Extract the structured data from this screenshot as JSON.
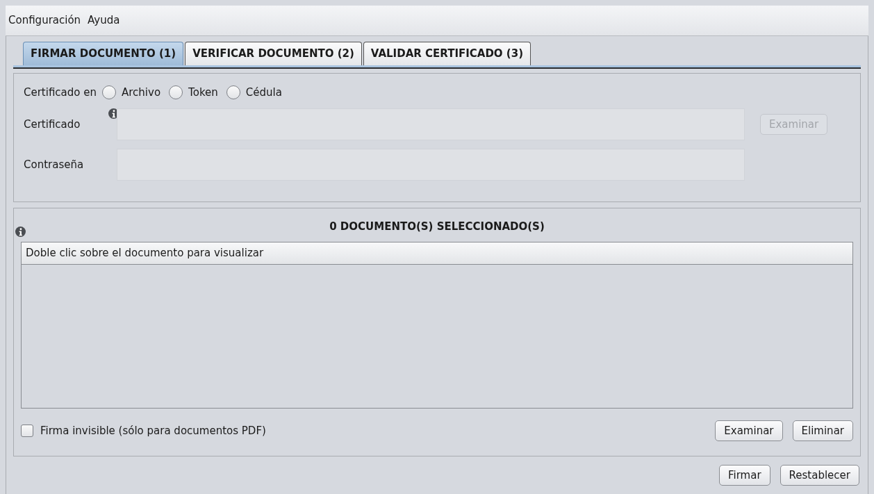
{
  "menu": [
    "Configuración",
    "Ayuda"
  ],
  "tabs": [
    {
      "label": "FIRMAR DOCUMENTO (1)",
      "selected": true
    },
    {
      "label": "VERIFICAR DOCUMENTO (2)",
      "selected": false
    },
    {
      "label": "VALIDAR CERTIFICADO (3)",
      "selected": false
    }
  ],
  "certificate": {
    "source_label": "Certificado en",
    "sources": [
      {
        "label": "Archivo",
        "selected": false
      },
      {
        "label": "Token",
        "selected": false
      },
      {
        "label": "Cédula",
        "selected": false
      }
    ],
    "fields": [
      {
        "label": "Certificado",
        "info": true,
        "disabled": true
      },
      {
        "label": "Contraseña",
        "info": false,
        "disabled": true
      }
    ],
    "browse_button": {
      "label": "Examinar",
      "disabled": true
    }
  },
  "documents": {
    "title": "0 DOCUMENTO(S) SELECCIONADO(S)",
    "list_header": "Doble clic sobre el documento para visualizar",
    "invisible_signature": {
      "label": "Firma invisible (sólo para documentos PDF)",
      "checked": false
    },
    "buttons": [
      "Examinar",
      "Eliminar"
    ]
  },
  "footer_buttons": [
    "Firmar",
    "Restablecer"
  ]
}
